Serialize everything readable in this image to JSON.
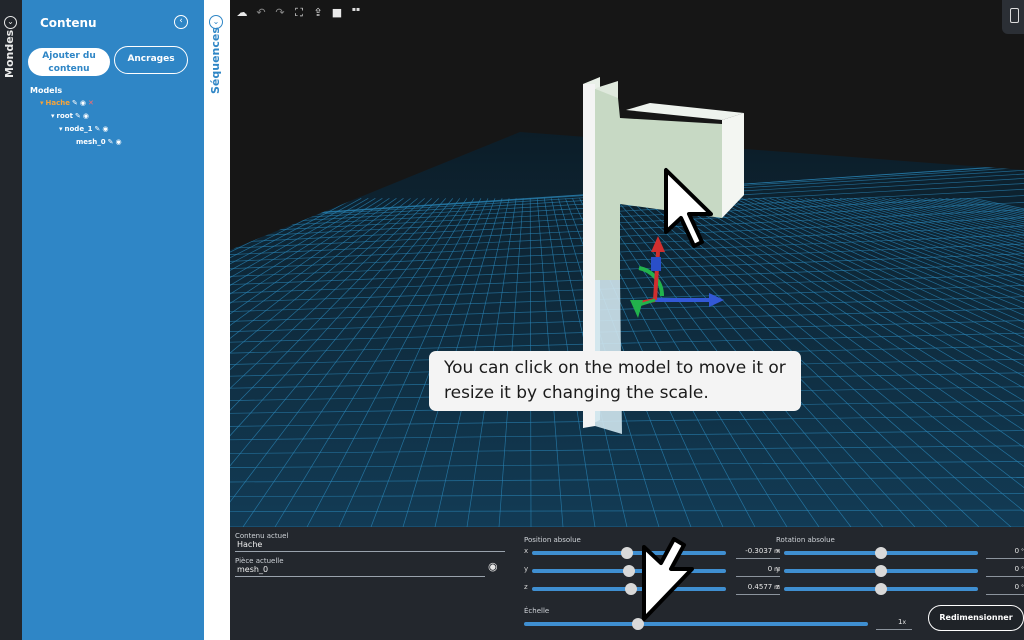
{
  "rail": {
    "label": "Mondes"
  },
  "panel": {
    "title": "Contenu",
    "add_button": "Ajouter du contenu",
    "anchors_button": "Ancrages",
    "models_title": "Models",
    "tree": [
      {
        "label": "Hache",
        "selected": true
      },
      {
        "label": "root"
      },
      {
        "label": "node_1"
      },
      {
        "label": "mesh_0"
      }
    ]
  },
  "sequences": {
    "label": "Séquences"
  },
  "tooltip": {
    "text": "You can click on the model to move it or resize it by changing the scale."
  },
  "props": {
    "current_content_label": "Contenu actuel",
    "current_content_value": "Hache",
    "current_piece_label": "Pièce actuelle",
    "current_piece_value": "mesh_0",
    "position_title": "Position absolue",
    "rotation_title": "Rotation absolue",
    "position": [
      {
        "axis": "x",
        "value": "-0.3037",
        "unit": "m",
        "level": 0.49
      },
      {
        "axis": "y",
        "value": "0",
        "unit": "m",
        "level": 0.5
      },
      {
        "axis": "z",
        "value": "0.4577",
        "unit": "m",
        "level": 0.51
      }
    ],
    "rotation": [
      {
        "axis": "x",
        "value": "0",
        "unit": "°",
        "level": 0.5
      },
      {
        "axis": "y",
        "value": "0",
        "unit": "°",
        "level": 0.5
      },
      {
        "axis": "z",
        "value": "0",
        "unit": "°",
        "level": 0.5
      }
    ],
    "scale_label": "Échelle",
    "scale_value": "1",
    "scale_unit": "x",
    "scale_level": 0.33,
    "resize_button": "Redimensionner"
  },
  "colors": {
    "panel_blue": "#2f86c6",
    "grid": "#2a86b8",
    "model_head": "#c5d8c3",
    "model_handle": "#ffffff"
  }
}
